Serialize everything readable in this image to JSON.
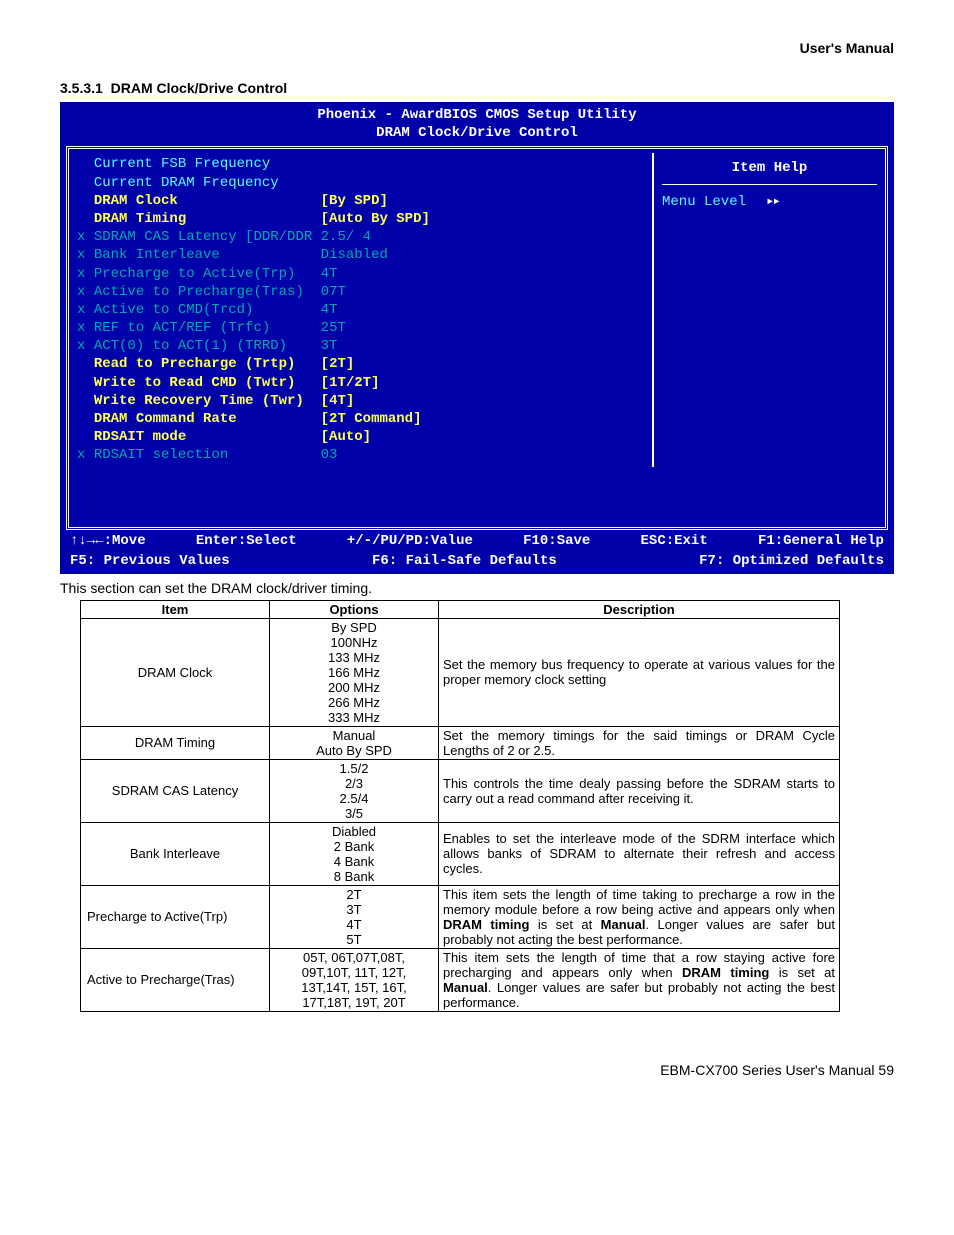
{
  "header": "User's Manual",
  "section": {
    "num": "3.5.3.1",
    "title": "DRAM Clock/Drive Control"
  },
  "bios": {
    "title": "Phoenix - AwardBIOS CMOS Setup Utility",
    "subtitle": "DRAM Clock/Drive Control",
    "help_title": "Item Help",
    "menu_level": "Menu Level",
    "rows": [
      {
        "prefix": "  ",
        "label": "Current FSB Frequency",
        "value": "",
        "label_cls": "cyan",
        "value_cls": ""
      },
      {
        "prefix": "  ",
        "label": "Current DRAM Frequency",
        "value": "",
        "label_cls": "cyan",
        "value_cls": ""
      },
      {
        "prefix": "  ",
        "label": "DRAM Clock",
        "value": "[By SPD]",
        "label_cls": "yellow",
        "value_cls": "yellow"
      },
      {
        "prefix": "  ",
        "label": "DRAM Timing",
        "value": "[Auto By SPD]",
        "label_cls": "yellow",
        "value_cls": "yellow"
      },
      {
        "prefix": "x ",
        "label": "SDRAM CAS Latency [DDR/DDR",
        "value": "2.5/ 4",
        "label_cls": "dark-cyan",
        "value_cls": "dark-cyan"
      },
      {
        "prefix": "x ",
        "label": "Bank Interleave",
        "value": "Disabled",
        "label_cls": "dark-cyan",
        "value_cls": "dark-cyan"
      },
      {
        "prefix": "x ",
        "label": "Precharge to Active(Trp)",
        "value": "4T",
        "label_cls": "dark-cyan",
        "value_cls": "dark-cyan"
      },
      {
        "prefix": "x ",
        "label": "Active to Precharge(Tras)",
        "value": "07T",
        "label_cls": "dark-cyan",
        "value_cls": "dark-cyan"
      },
      {
        "prefix": "x ",
        "label": "Active to CMD(Trcd)",
        "value": "4T",
        "label_cls": "dark-cyan",
        "value_cls": "dark-cyan"
      },
      {
        "prefix": "x ",
        "label": "REF to ACT/REF (Trfc)",
        "value": "25T",
        "label_cls": "dark-cyan",
        "value_cls": "dark-cyan"
      },
      {
        "prefix": "x ",
        "label": "ACT(0) to ACT(1) (TRRD)",
        "value": "3T",
        "label_cls": "dark-cyan",
        "value_cls": "dark-cyan"
      },
      {
        "prefix": "  ",
        "label": "Read to Precharge (Trtp)",
        "value": "[2T]",
        "label_cls": "yellow",
        "value_cls": "yellow"
      },
      {
        "prefix": "  ",
        "label": "Write to Read CMD (Twtr)",
        "value": "[1T/2T]",
        "label_cls": "yellow",
        "value_cls": "yellow"
      },
      {
        "prefix": "  ",
        "label": "Write Recovery Time (Twr)",
        "value": "[4T]",
        "label_cls": "yellow",
        "value_cls": "yellow"
      },
      {
        "prefix": "  ",
        "label": "DRAM Command Rate",
        "value": "[2T Command]",
        "label_cls": "yellow",
        "value_cls": "yellow"
      },
      {
        "prefix": "  ",
        "label": "RDSAIT mode",
        "value": "[Auto]",
        "label_cls": "yellow",
        "value_cls": "yellow"
      },
      {
        "prefix": "x ",
        "label": "RDSAIT selection",
        "value": "03",
        "label_cls": "dark-cyan",
        "value_cls": "dark-cyan"
      }
    ],
    "footer1": {
      "a": "↑↓→←:Move",
      "b": "Enter:Select",
      "c": "+/-/PU/PD:Value",
      "d": "F10:Save",
      "e": "ESC:Exit",
      "f": "F1:General Help"
    },
    "footer2": {
      "a": "F5: Previous Values",
      "b": "F6: Fail-Safe Defaults",
      "c": "F7: Optimized Defaults"
    }
  },
  "caption": "This section can set the DRAM clock/driver timing.",
  "table": {
    "headers": {
      "item": "Item",
      "options": "Options",
      "desc": "Description"
    },
    "rows": [
      {
        "item": "DRAM Clock",
        "item_align": "center",
        "options": "By SPD\n100NHz\n133 MHz\n166 MHz\n200 MHz\n266 MHz\n333 MHz",
        "desc": "Set the memory bus frequency to operate at various values for the proper memory clock setting"
      },
      {
        "item": "DRAM Timing",
        "item_align": "center",
        "options": "Manual\nAuto By SPD",
        "desc": "Set the memory timings for the said timings or DRAM Cycle Lengths of 2 or 2.5."
      },
      {
        "item": "SDRAM CAS Latency",
        "item_align": "center",
        "options": "1.5/2\n2/3\n2.5/4\n3/5",
        "desc": "This controls the time dealy passing before the SDRAM starts to carry out a read command after receiving it."
      },
      {
        "item": "Bank Interleave",
        "item_align": "center",
        "options": "Diabled\n2 Bank\n4 Bank\n8 Bank",
        "desc": "Enables to set the interleave mode of the SDRM interface which allows banks of SDRAM to alternate their refresh and access cycles."
      },
      {
        "item": "Precharge to Active(Trp)",
        "item_align": "left",
        "options": "2T\n3T\n4T\n5T",
        "desc_html": "This item sets the length of time taking to precharge a row in the memory module before a row being active and appears only when <b>DRAM timing</b> is set at <b>Manual</b>. Longer values are safer but probably not acting the best performance."
      },
      {
        "item": "Active to Precharge(Tras)",
        "item_align": "left",
        "options": "05T, 06T,07T,08T,\n09T,10T, 11T, 12T,\n13T,14T, 15T, 16T,\n17T,18T, 19T, 20T",
        "desc_html": "This item sets the length of time that a row staying active fore precharging and appears only when <b>DRAM timing</b> is set at <b>Manual</b>. Longer values are safer but probably not acting the best performance."
      }
    ]
  },
  "footer": "EBM-CX700 Series User's Manual 59"
}
